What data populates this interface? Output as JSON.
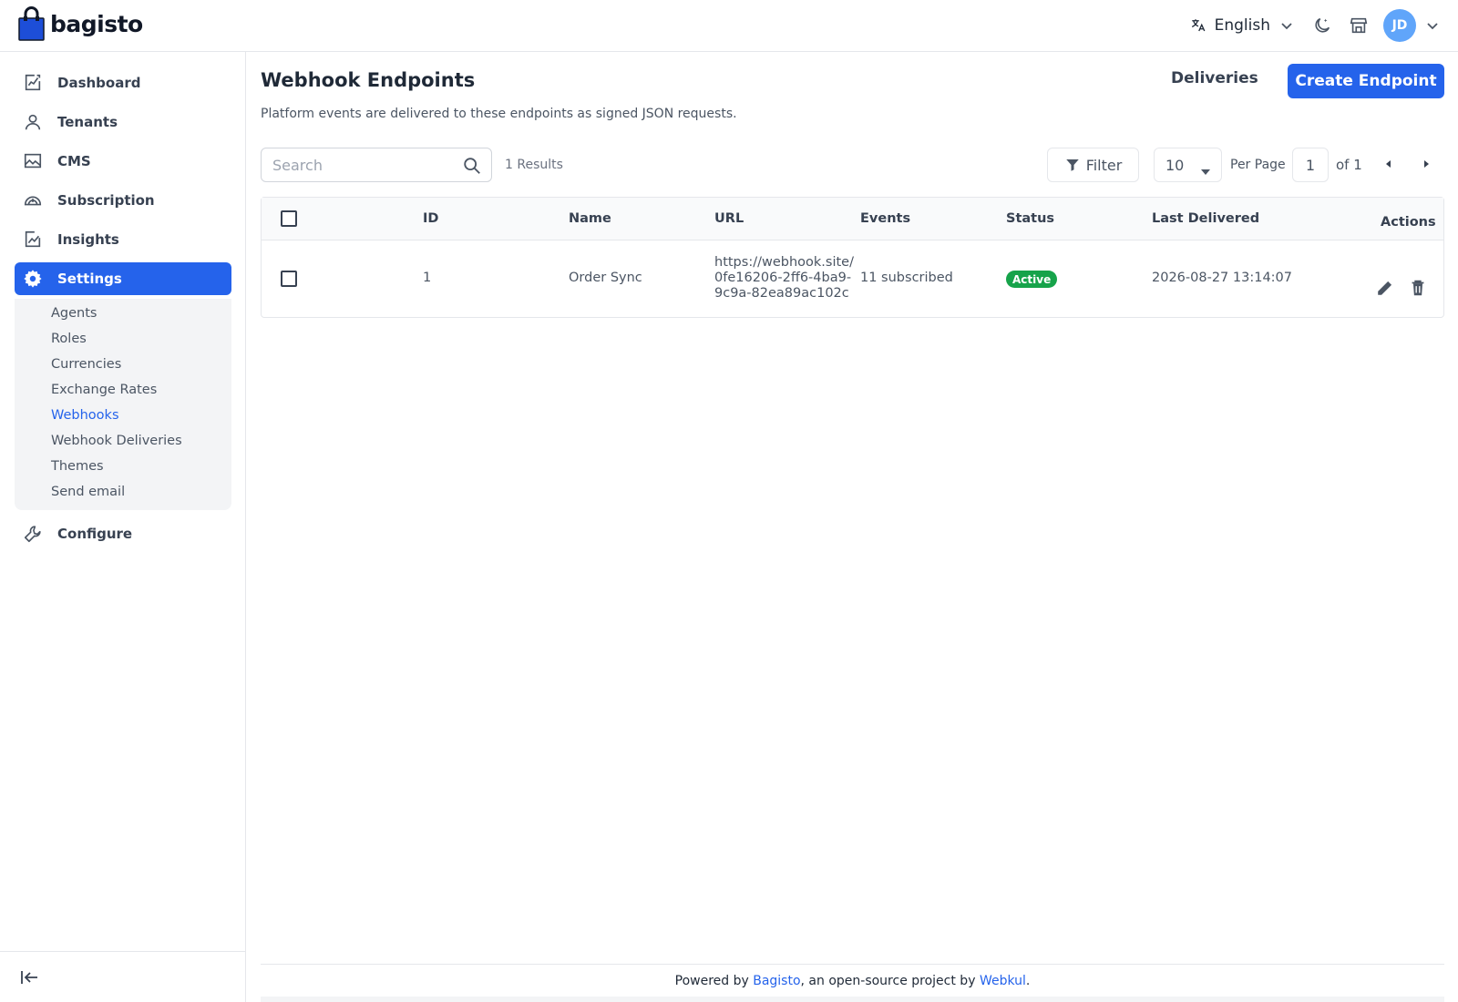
{
  "header": {
    "logo_text": "bagisto",
    "language": "English",
    "avatar_initials": "JD",
    "brand_color": "#1d4ed8"
  },
  "sidebar": {
    "items": [
      {
        "label": "Dashboard",
        "icon": "dashboard-icon"
      },
      {
        "label": "Tenants",
        "icon": "user-icon"
      },
      {
        "label": "CMS",
        "icon": "cms-icon"
      },
      {
        "label": "Subscription",
        "icon": "subscription-icon"
      },
      {
        "label": "Insights",
        "icon": "insights-icon"
      },
      {
        "label": "Settings",
        "icon": "gear-icon",
        "active": true
      },
      {
        "label": "Configure",
        "icon": "wrench-icon"
      }
    ],
    "settings_submenu": [
      {
        "label": "Agents"
      },
      {
        "label": "Roles"
      },
      {
        "label": "Currencies"
      },
      {
        "label": "Exchange Rates"
      },
      {
        "label": "Webhooks",
        "active": true
      },
      {
        "label": "Webhook Deliveries"
      },
      {
        "label": "Themes"
      },
      {
        "label": "Send email"
      }
    ],
    "accent_color": "#2563eb"
  },
  "main": {
    "title": "Webhook Endpoints",
    "subtitle": "Platform events are delivered to these endpoints as signed JSON requests.",
    "deliveries_label": "Deliveries",
    "create_label": "Create Endpoint",
    "search_placeholder": "Search",
    "results_text": "1 Results",
    "filter_label": "Filter",
    "per_page_value": "10",
    "per_page_label": "Per Page",
    "current_page": "1",
    "page_of": "of 1"
  },
  "table": {
    "columns": [
      "ID",
      "Name",
      "URL",
      "Events",
      "Status",
      "Last Delivered",
      "Actions"
    ],
    "rows": [
      {
        "id": "1",
        "name": "Order Sync",
        "url_lines": [
          "https://webhook.site/",
          "0fe16206-2ff6-4ba9-",
          "9c9a-82ea89ac102c"
        ],
        "events": "11 subscribed",
        "status": "Active",
        "status_color": "#16a34a",
        "last_delivered": "2026-08-27 13:14:07"
      }
    ]
  },
  "footer": {
    "prefix": "Powered by ",
    "link1": "Bagisto",
    "middle": ", an open-source project by ",
    "link2": "Webkul",
    "suffix": "."
  }
}
